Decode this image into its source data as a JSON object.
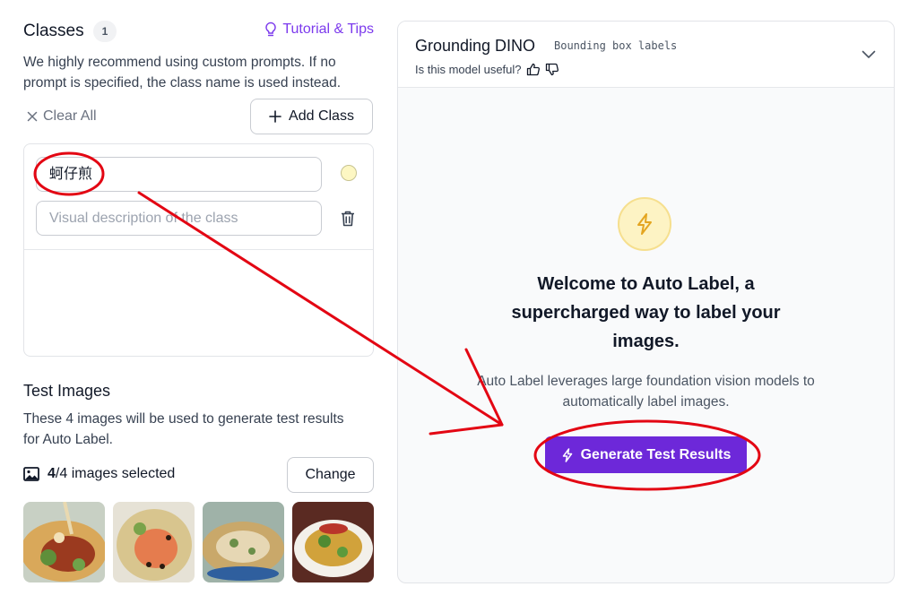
{
  "classes": {
    "title": "Classes",
    "count": "1",
    "tutorial_link": "Tutorial & Tips",
    "description": "We highly recommend using custom prompts. If no prompt is specified, the class name is used instead.",
    "clear_all": "Clear All",
    "add_class": "Add Class",
    "items": [
      {
        "name_value": "蚵仔煎",
        "description_placeholder": "Visual description of the class",
        "color": "#fdf7c3"
      }
    ]
  },
  "test_images": {
    "title": "Test Images",
    "description": "These 4 images will be used to generate test results for Auto Label.",
    "selected_count": "4",
    "selected_suffix": "/4 images selected",
    "change_button": "Change",
    "thumbnail_count": 4
  },
  "panel": {
    "model_name": "Grounding DINO",
    "model_tag": "Bounding box labels",
    "useful_question": "Is this model useful?",
    "welcome_title": "Welcome to Auto Label, a supercharged way to label your images.",
    "welcome_subtitle": "Auto Label leverages large foundation vision models to automatically label images.",
    "generate_button": "Generate Test Results"
  },
  "colors": {
    "accent": "#6d28d9",
    "link": "#7c3aed",
    "annotation": "#e30613",
    "bolt": "#e4a521"
  }
}
